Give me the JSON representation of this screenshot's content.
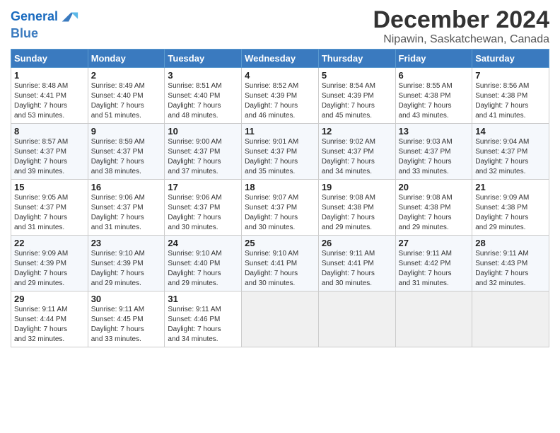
{
  "logo": {
    "line1": "General",
    "line2": "Blue"
  },
  "title": "December 2024",
  "location": "Nipawin, Saskatchewan, Canada",
  "days_of_week": [
    "Sunday",
    "Monday",
    "Tuesday",
    "Wednesday",
    "Thursday",
    "Friday",
    "Saturday"
  ],
  "weeks": [
    [
      {
        "day": "1",
        "sunrise": "8:48 AM",
        "sunset": "4:41 PM",
        "daylight": "7 hours and 53 minutes."
      },
      {
        "day": "2",
        "sunrise": "8:49 AM",
        "sunset": "4:40 PM",
        "daylight": "7 hours and 51 minutes."
      },
      {
        "day": "3",
        "sunrise": "8:51 AM",
        "sunset": "4:40 PM",
        "daylight": "7 hours and 48 minutes."
      },
      {
        "day": "4",
        "sunrise": "8:52 AM",
        "sunset": "4:39 PM",
        "daylight": "7 hours and 46 minutes."
      },
      {
        "day": "5",
        "sunrise": "8:54 AM",
        "sunset": "4:39 PM",
        "daylight": "7 hours and 45 minutes."
      },
      {
        "day": "6",
        "sunrise": "8:55 AM",
        "sunset": "4:38 PM",
        "daylight": "7 hours and 43 minutes."
      },
      {
        "day": "7",
        "sunrise": "8:56 AM",
        "sunset": "4:38 PM",
        "daylight": "7 hours and 41 minutes."
      }
    ],
    [
      {
        "day": "8",
        "sunrise": "8:57 AM",
        "sunset": "4:37 PM",
        "daylight": "7 hours and 39 minutes."
      },
      {
        "day": "9",
        "sunrise": "8:59 AM",
        "sunset": "4:37 PM",
        "daylight": "7 hours and 38 minutes."
      },
      {
        "day": "10",
        "sunrise": "9:00 AM",
        "sunset": "4:37 PM",
        "daylight": "7 hours and 37 minutes."
      },
      {
        "day": "11",
        "sunrise": "9:01 AM",
        "sunset": "4:37 PM",
        "daylight": "7 hours and 35 minutes."
      },
      {
        "day": "12",
        "sunrise": "9:02 AM",
        "sunset": "4:37 PM",
        "daylight": "7 hours and 34 minutes."
      },
      {
        "day": "13",
        "sunrise": "9:03 AM",
        "sunset": "4:37 PM",
        "daylight": "7 hours and 33 minutes."
      },
      {
        "day": "14",
        "sunrise": "9:04 AM",
        "sunset": "4:37 PM",
        "daylight": "7 hours and 32 minutes."
      }
    ],
    [
      {
        "day": "15",
        "sunrise": "9:05 AM",
        "sunset": "4:37 PM",
        "daylight": "7 hours and 31 minutes."
      },
      {
        "day": "16",
        "sunrise": "9:06 AM",
        "sunset": "4:37 PM",
        "daylight": "7 hours and 31 minutes."
      },
      {
        "day": "17",
        "sunrise": "9:06 AM",
        "sunset": "4:37 PM",
        "daylight": "7 hours and 30 minutes."
      },
      {
        "day": "18",
        "sunrise": "9:07 AM",
        "sunset": "4:37 PM",
        "daylight": "7 hours and 30 minutes."
      },
      {
        "day": "19",
        "sunrise": "9:08 AM",
        "sunset": "4:38 PM",
        "daylight": "7 hours and 29 minutes."
      },
      {
        "day": "20",
        "sunrise": "9:08 AM",
        "sunset": "4:38 PM",
        "daylight": "7 hours and 29 minutes."
      },
      {
        "day": "21",
        "sunrise": "9:09 AM",
        "sunset": "4:38 PM",
        "daylight": "7 hours and 29 minutes."
      }
    ],
    [
      {
        "day": "22",
        "sunrise": "9:09 AM",
        "sunset": "4:39 PM",
        "daylight": "7 hours and 29 minutes."
      },
      {
        "day": "23",
        "sunrise": "9:10 AM",
        "sunset": "4:39 PM",
        "daylight": "7 hours and 29 minutes."
      },
      {
        "day": "24",
        "sunrise": "9:10 AM",
        "sunset": "4:40 PM",
        "daylight": "7 hours and 29 minutes."
      },
      {
        "day": "25",
        "sunrise": "9:10 AM",
        "sunset": "4:41 PM",
        "daylight": "7 hours and 30 minutes."
      },
      {
        "day": "26",
        "sunrise": "9:11 AM",
        "sunset": "4:41 PM",
        "daylight": "7 hours and 30 minutes."
      },
      {
        "day": "27",
        "sunrise": "9:11 AM",
        "sunset": "4:42 PM",
        "daylight": "7 hours and 31 minutes."
      },
      {
        "day": "28",
        "sunrise": "9:11 AM",
        "sunset": "4:43 PM",
        "daylight": "7 hours and 32 minutes."
      }
    ],
    [
      {
        "day": "29",
        "sunrise": "9:11 AM",
        "sunset": "4:44 PM",
        "daylight": "7 hours and 32 minutes."
      },
      {
        "day": "30",
        "sunrise": "9:11 AM",
        "sunset": "4:45 PM",
        "daylight": "7 hours and 33 minutes."
      },
      {
        "day": "31",
        "sunrise": "9:11 AM",
        "sunset": "4:46 PM",
        "daylight": "7 hours and 34 minutes."
      },
      null,
      null,
      null,
      null
    ]
  ],
  "labels": {
    "sunrise": "Sunrise:",
    "sunset": "Sunset:",
    "daylight": "Daylight:"
  }
}
